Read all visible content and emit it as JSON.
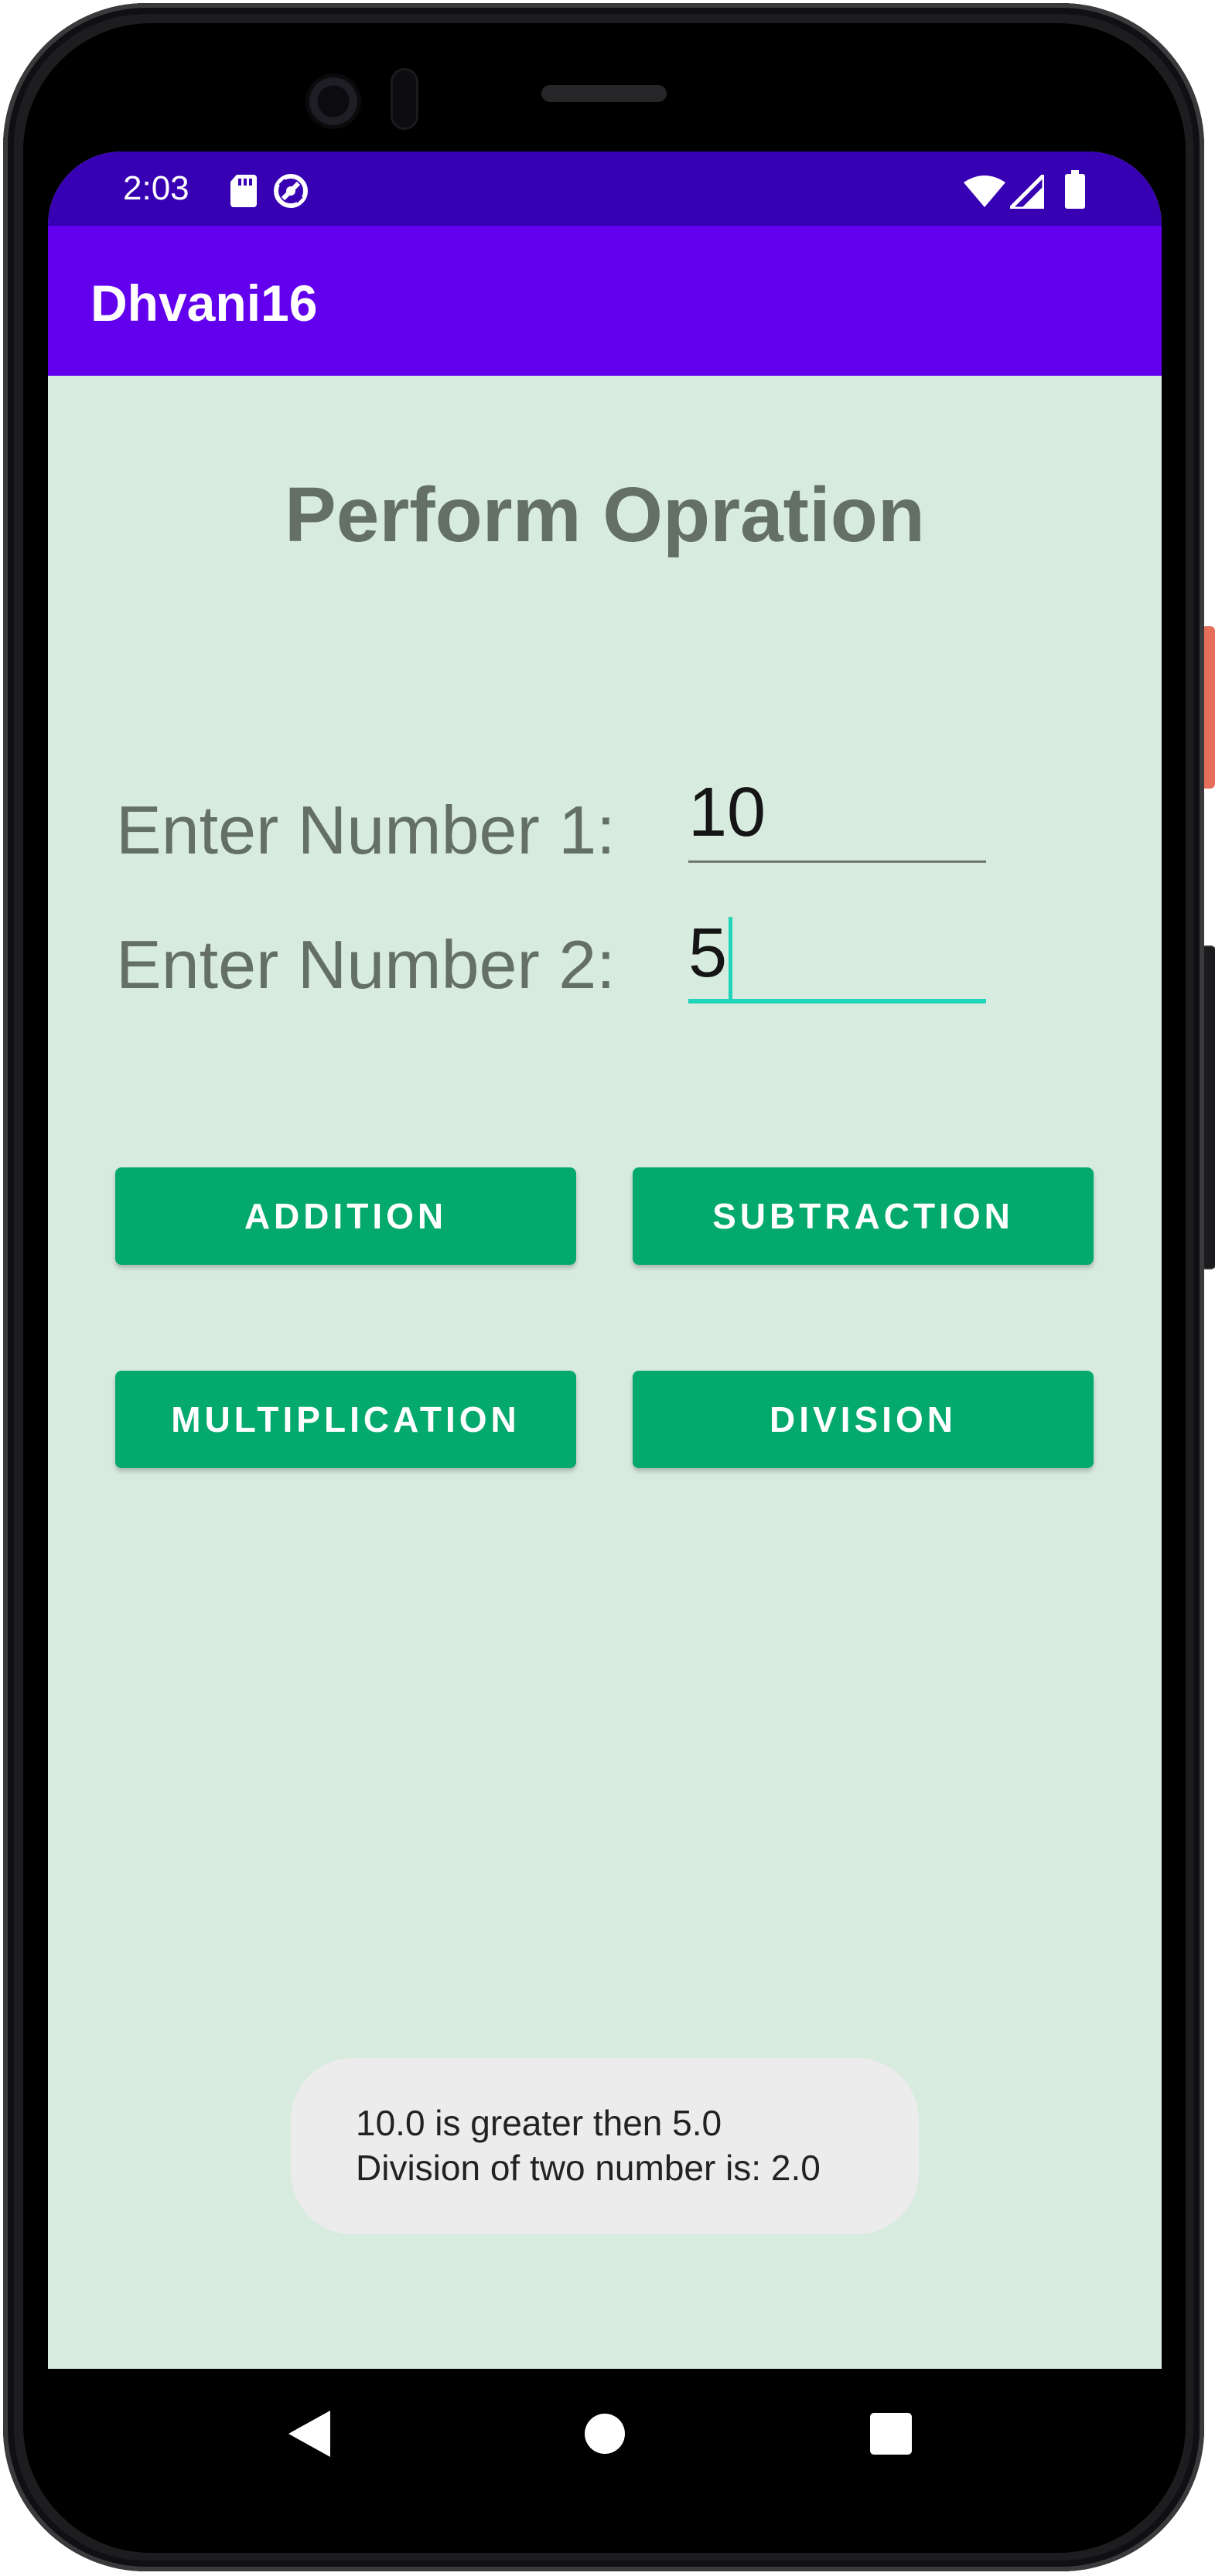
{
  "status_bar": {
    "time": "2:03",
    "left_icons": [
      "sd-card-icon",
      "data-saver-icon"
    ],
    "right_icons": [
      "wifi-icon",
      "cellular-signal-icon",
      "battery-icon"
    ],
    "color": "#3700b3"
  },
  "app_bar": {
    "title": "Dhvani16",
    "color": "#6200ee"
  },
  "main": {
    "heading": "Perform Opration",
    "background": "#d8ebdf",
    "number1": {
      "label": "Enter Number 1:",
      "value": "10"
    },
    "number2": {
      "label": "Enter Number 2:",
      "value": "5"
    },
    "buttons": {
      "addition": "ADDITION",
      "subtraction": "SUBTRACTION",
      "multiplication": "MULTIPLICATION",
      "division": "DIVISION"
    },
    "button_color": "#03a96d",
    "focus_color": "#1ed5b9"
  },
  "toast": {
    "line1": "10.0 is greater then 5.0",
    "line2": "Division of two number is: 2.0"
  },
  "nav_bar": {
    "icons": [
      "back-icon",
      "home-icon",
      "recents-icon"
    ]
  }
}
